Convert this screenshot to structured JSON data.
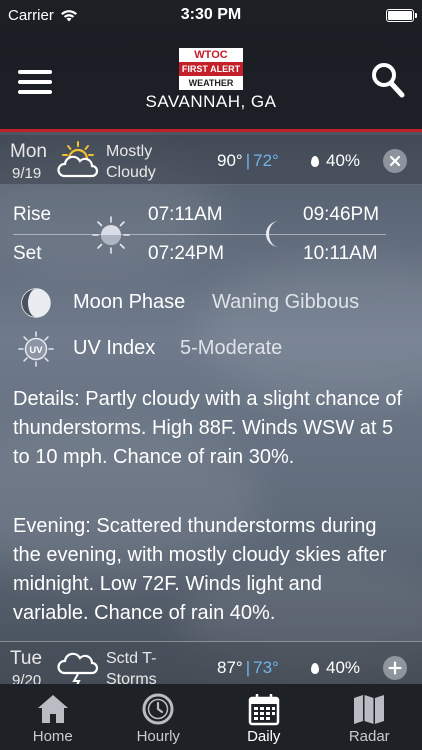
{
  "status_bar": {
    "carrier": "Carrier",
    "time": "3:30 PM"
  },
  "header": {
    "logo": {
      "line1": "WTOC",
      "line2": "FIRST ALERT",
      "line3": "WEATHER"
    },
    "location": "SAVANNAH, GA",
    "accent_color": "#c3202a"
  },
  "today": {
    "day": "Mon",
    "date": "9/19",
    "condition": "Mostly Cloudy",
    "condition_icon": "partly-cloudy-icon",
    "high": "90°",
    "low": "72°",
    "separator": "|",
    "precip": "40%",
    "collapse_icon": "close-icon"
  },
  "rise_set": {
    "rise_label": "Rise",
    "set_label": "Set",
    "sunrise": "07:11AM",
    "sunset": "07:24PM",
    "moonrise": "09:46PM",
    "moonset": "10:11AM"
  },
  "moon_phase": {
    "label": "Moon Phase",
    "value": "Waning Gibbous"
  },
  "uv_index": {
    "label": "UV Index",
    "value": "5-Moderate",
    "icon_text": "UV"
  },
  "details": {
    "day_text": "Details: Partly cloudy with a slight chance of thunderstorms. High 88F. Winds WSW at 5 to 10 mph. Chance of rain 30%.",
    "evening_text": "Evening: Scattered thunderstorms during the evening, with mostly cloudy skies after midnight. Low 72F. Winds light and variable. Chance of rain 40%."
  },
  "next_day": {
    "day": "Tue",
    "date": "9/20",
    "condition": "Sctd T-Storms",
    "condition_icon": "thunderstorm-icon",
    "high": "87°",
    "low": "73°",
    "separator": "|",
    "precip": "40%",
    "expand_icon": "plus-icon"
  },
  "tabs": [
    {
      "label": "Home",
      "icon": "home-icon",
      "active": false
    },
    {
      "label": "Hourly",
      "icon": "clock-icon",
      "active": false
    },
    {
      "label": "Daily",
      "icon": "calendar-icon",
      "active": true
    },
    {
      "label": "Radar",
      "icon": "map-icon",
      "active": false
    }
  ],
  "colors": {
    "low_temp": "#6fb3e8",
    "tab_bar": "#1e2126"
  }
}
